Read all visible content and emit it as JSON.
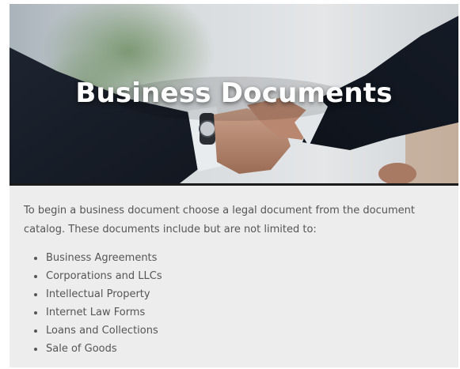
{
  "hero": {
    "title": "Business Documents",
    "image": "handshake-photo"
  },
  "content": {
    "intro": "To begin a business document choose a legal document from the document catalog. These documents include but are not limited to:",
    "items": [
      {
        "label": "Business Agreements"
      },
      {
        "label": "Corporations and LLCs"
      },
      {
        "label": "Intellectual Property"
      },
      {
        "label": "Internet Law Forms"
      },
      {
        "label": "Loans and Collections"
      },
      {
        "label": "Sale of Goods"
      }
    ]
  },
  "colors": {
    "card_background": "#ededed",
    "text": "#555555",
    "title": "#ffffff",
    "divider": "#1b1b1b"
  }
}
